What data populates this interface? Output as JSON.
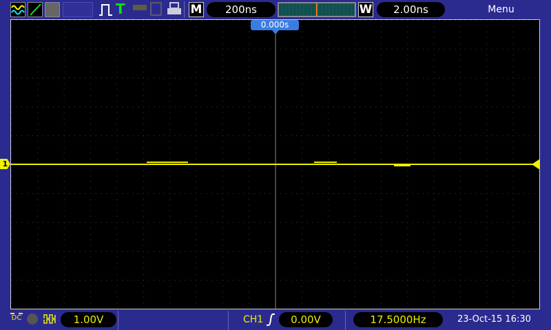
{
  "toolbar": {
    "icons": [
      "channel-waves-icon",
      "math-ramp-icon",
      "reference-icon",
      "blank-slot",
      "pulse-icon",
      "trigger-T-icon",
      "key-icon",
      "save-icon",
      "printer-icon"
    ],
    "timebase_mode": "M",
    "timebase": "200ns",
    "window_mode": "W",
    "window_timebase": "2.00ns",
    "menu": "Menu"
  },
  "plot": {
    "trigger_time": "0.000s",
    "channel_marker": "1"
  },
  "status": {
    "coupling": "DC",
    "ch1_scale": "1.00V",
    "trigger_source": "CH1",
    "trigger_level": "0.00V",
    "frequency": "17.5000Hz",
    "datetime": "23-Oct-15 16:30"
  },
  "colors": {
    "background": "#2b2b8f",
    "trace": "#f0f000",
    "accent": "#3a7de0"
  }
}
